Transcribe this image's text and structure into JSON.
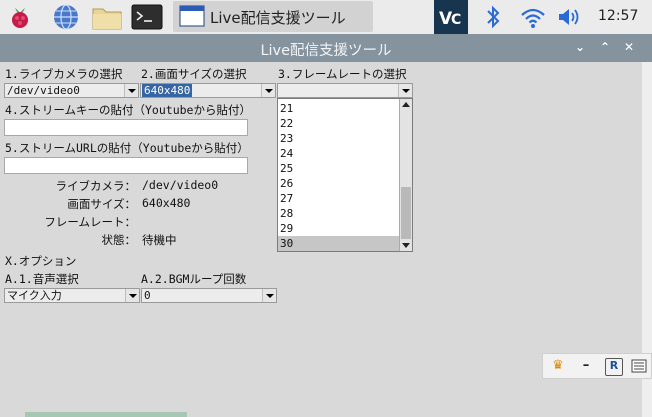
{
  "taskbar": {
    "task_title": "Live配信支援ツール",
    "clock": "12:57",
    "icons": [
      "raspberry-menu-icon",
      "globe-icon",
      "folder-icon",
      "terminal-icon",
      "window-app-icon",
      "vnc-icon",
      "bluetooth-icon",
      "wifi-icon",
      "volume-icon"
    ]
  },
  "window": {
    "title": "Live配信支援ツール",
    "buttons": {
      "minimize": "⌄",
      "maximize": "⌃",
      "close": "✕"
    }
  },
  "form": {
    "camera_label": "1.ライブカメラの選択",
    "camera_value": "/dev/video0",
    "size_label": "2.画面サイズの選択",
    "size_value": "640x480",
    "framerate_label": "3.フレームレートの選択",
    "framerate_value": "",
    "framerate_options": [
      "21",
      "22",
      "23",
      "24",
      "25",
      "26",
      "27",
      "28",
      "29",
      "30"
    ],
    "framerate_selected": "30",
    "stream_key_label": "4.ストリームキーの貼付（Youtubeから貼付）",
    "stream_key_value": "",
    "stream_url_label": "5.ストリームURLの貼付（Youtubeから貼付）",
    "stream_url_value": ""
  },
  "status": {
    "camera_label": "ライブカメラ：",
    "camera_value": "/dev/video0",
    "size_label": "画面サイズ：",
    "size_value": "640x480",
    "framerate_label": "フレームレート：",
    "framerate_value": "",
    "state_label": "状態：",
    "state_value": "待機中"
  },
  "options": {
    "title": "X.オプション",
    "audio_label": "A.1.音声選択",
    "audio_value": "マイク入力",
    "bgm_label": "A.2.BGMループ回数",
    "bgm_value": "0"
  },
  "mini_toolbar": {
    "icons": [
      "crown-icon",
      "minimize-icon",
      "r-icon",
      "list-icon"
    ]
  },
  "colors": {
    "titlebar": "#84939e",
    "selection": "#3465a4",
    "panel": "#d9d9d9"
  }
}
